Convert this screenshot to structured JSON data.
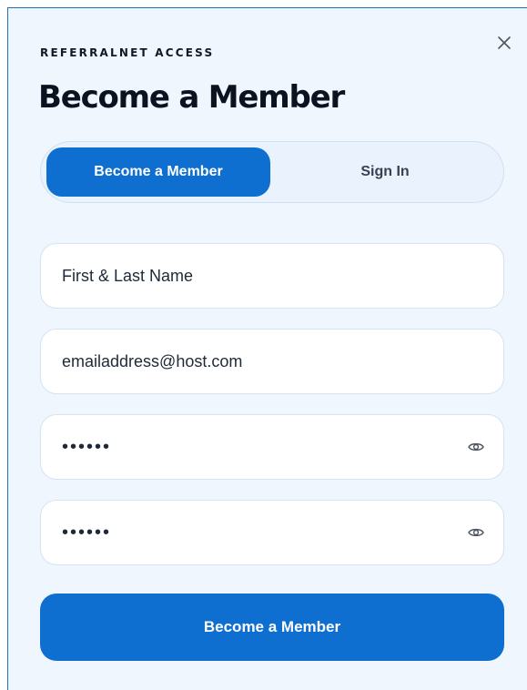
{
  "modal": {
    "eyebrow": "REFERRALNET ACCESS",
    "title": "Become a Member",
    "close_icon": "close-icon"
  },
  "tabs": [
    {
      "label": "Become a Member",
      "active": true
    },
    {
      "label": "Sign In",
      "active": false
    }
  ],
  "form": {
    "name_value": "First & Last Name",
    "email_value": "emailaddress@host.com",
    "password_value": "••••••",
    "confirm_password_value": "••••••",
    "reveal_icon": "eye-icon",
    "submit_label": "Become a Member"
  },
  "colors": {
    "accent": "#0f6fd0",
    "panel_bg": "#eff6fe",
    "field_border": "#d5e3f2"
  }
}
